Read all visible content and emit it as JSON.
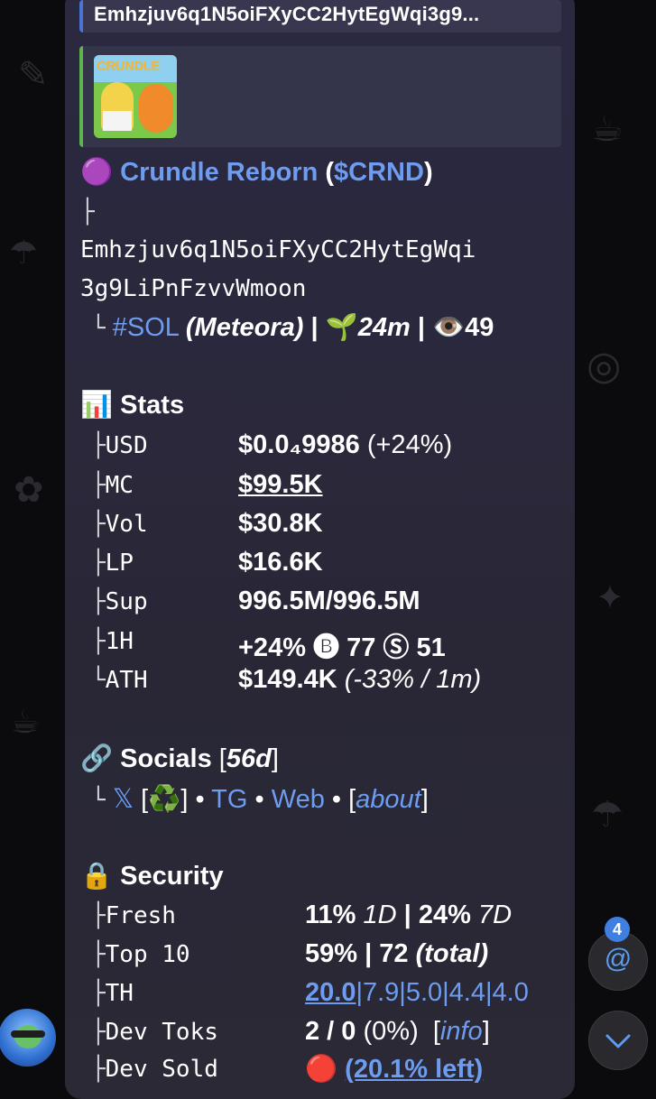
{
  "quote_address": "Emhzjuv6q1N5oiFXyCC2HytEgWqi3g9...",
  "thumbnail_caption": "CRUNDLE",
  "token": {
    "dot": "🟣",
    "name": "Crundle Reborn",
    "open_paren": "(",
    "ticker": "$CRND",
    "close_paren": ")",
    "tree_branch": "├",
    "address_line1": "Emhzjuv6q1N5oiFXyCC2HytEgWqi",
    "address_line2": "3g9LiPnFzvvWmoon",
    "tree_end": "└",
    "chain": "#SOL",
    "dex": "(Meteora)",
    "sep1": "|",
    "sprout": "🌱",
    "age": "24m",
    "sep2": "|",
    "eye": "👁️",
    "views": "49"
  },
  "stats": {
    "icon": "📊",
    "title": "Stats",
    "rows": [
      {
        "branch": "├",
        "label": "USD",
        "value": "$0.0₄9986",
        "extra": "(+24%)"
      },
      {
        "branch": "├",
        "label": "MC",
        "value": "$99.5K"
      },
      {
        "branch": "├",
        "label": "Vol",
        "value": "$30.8K"
      },
      {
        "branch": "├",
        "label": "LP",
        "value": "$16.6K"
      },
      {
        "branch": "├",
        "label": "Sup",
        "value": "996.5M/996.5M"
      },
      {
        "branch": "├",
        "label": "1H",
        "value": "+24% 🅑 77 Ⓢ 51"
      },
      {
        "branch": "└",
        "label": "ATH",
        "value": "$149.4K",
        "extra": "(-33% / 1m)"
      }
    ]
  },
  "socials": {
    "icon": "🔗",
    "title": "Socials",
    "age_open": "[",
    "age": "56d",
    "age_close": "]",
    "branch": "└",
    "x": "𝕏",
    "recycle": "[♻️]",
    "dot": "•",
    "tg": "TG",
    "web": "Web",
    "about_open": "[",
    "about": "about",
    "about_close": "]"
  },
  "security": {
    "icon": "🔒",
    "title": "Security",
    "fresh": {
      "branch": "├",
      "label": "Fresh",
      "v1": "11%",
      "v1i": "1D",
      "sep": "|",
      "v2": "24%",
      "v2i": "7D"
    },
    "top10": {
      "branch": "├",
      "label": "Top 10",
      "v": "59% | 72",
      "vi": "(total)"
    },
    "th": {
      "branch": "├",
      "label": "TH",
      "first": "20.0",
      "rest": "|7.9|5.0|4.4|4.0"
    },
    "devtoks": {
      "branch": "├",
      "label": "Dev Toks",
      "v": "2 / 0",
      "pct": "(0%)",
      "open": "[",
      "info": "info",
      "close": "]"
    },
    "devsold": {
      "branch": "├",
      "label": "Dev Sold",
      "icon": "🔴",
      "v": "(20.1% left)"
    }
  },
  "mentions": {
    "count": "4",
    "symbol": "@"
  },
  "scroll_down": "⌄"
}
